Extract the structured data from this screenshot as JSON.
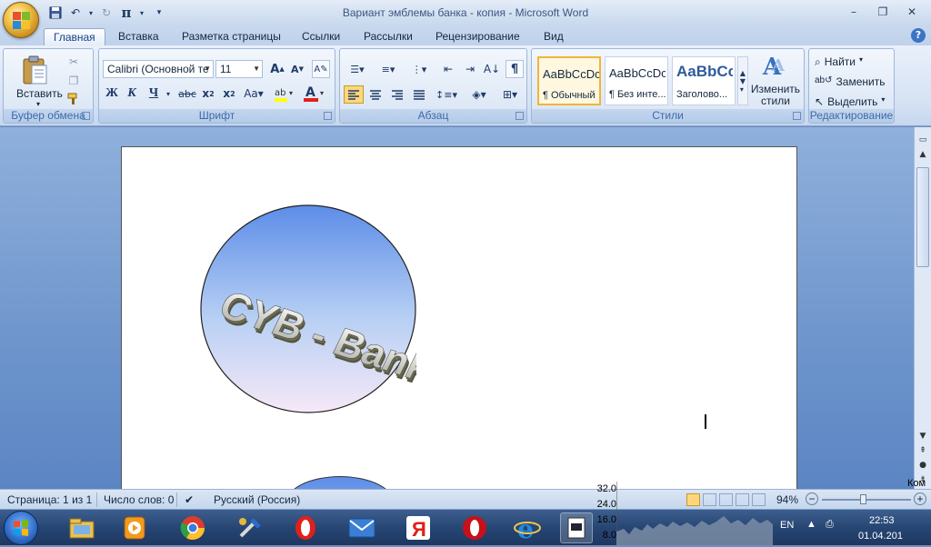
{
  "window": {
    "title": "Вариант эмблемы банка - копия - Microsoft Word"
  },
  "qat": {
    "save": "save-icon",
    "undo": "undo-icon",
    "redo": "redo-icon",
    "equation": "π"
  },
  "tabs": [
    "Главная",
    "Вставка",
    "Разметка страницы",
    "Ссылки",
    "Рассылки",
    "Рецензирование",
    "Вид"
  ],
  "ribbon": {
    "clipboard": {
      "label": "Буфер обмена",
      "paste": "Вставить"
    },
    "font": {
      "label": "Шрифт",
      "family": "Calibri (Основной те",
      "size": "11"
    },
    "paragraph": {
      "label": "Абзац"
    },
    "styles": {
      "label": "Стили",
      "items": [
        {
          "preview": "AaBbCcDc",
          "name": "¶ Обычный"
        },
        {
          "preview": "AaBbCcDc",
          "name": "¶ Без инте..."
        },
        {
          "preview": "AaBbCс",
          "name": "Заголово..."
        }
      ],
      "change": "Изменить стили"
    },
    "editing": {
      "label": "Редактирование",
      "find": "Найти",
      "replace": "Заменить",
      "select": "Выделить"
    }
  },
  "document": {
    "emblem_text": "CYB - Bank"
  },
  "status": {
    "page": "Страница: 1 из 1",
    "words": "Число слов: 0",
    "language": "Русский (Россия)",
    "zoom": "94%",
    "zoom_level": 0.94
  },
  "taskbar": {
    "apps": [
      "windows-explorer",
      "media-player",
      "chrome",
      "tools",
      "opera",
      "mail",
      "yandex",
      "opera-red",
      "internet-explorer",
      "word-document"
    ],
    "graph_labels": [
      "32.0",
      "24.0",
      "16.0",
      "8.0"
    ],
    "lang": "EN",
    "time": "22:53",
    "date": "01.04.201",
    "kom": "Ком"
  },
  "colors": {
    "accent": "#15428b",
    "ribbon_label": "#3e6aaa",
    "emblem_top": "#5d8de8",
    "emblem_bottom": "#f6e8f7"
  }
}
